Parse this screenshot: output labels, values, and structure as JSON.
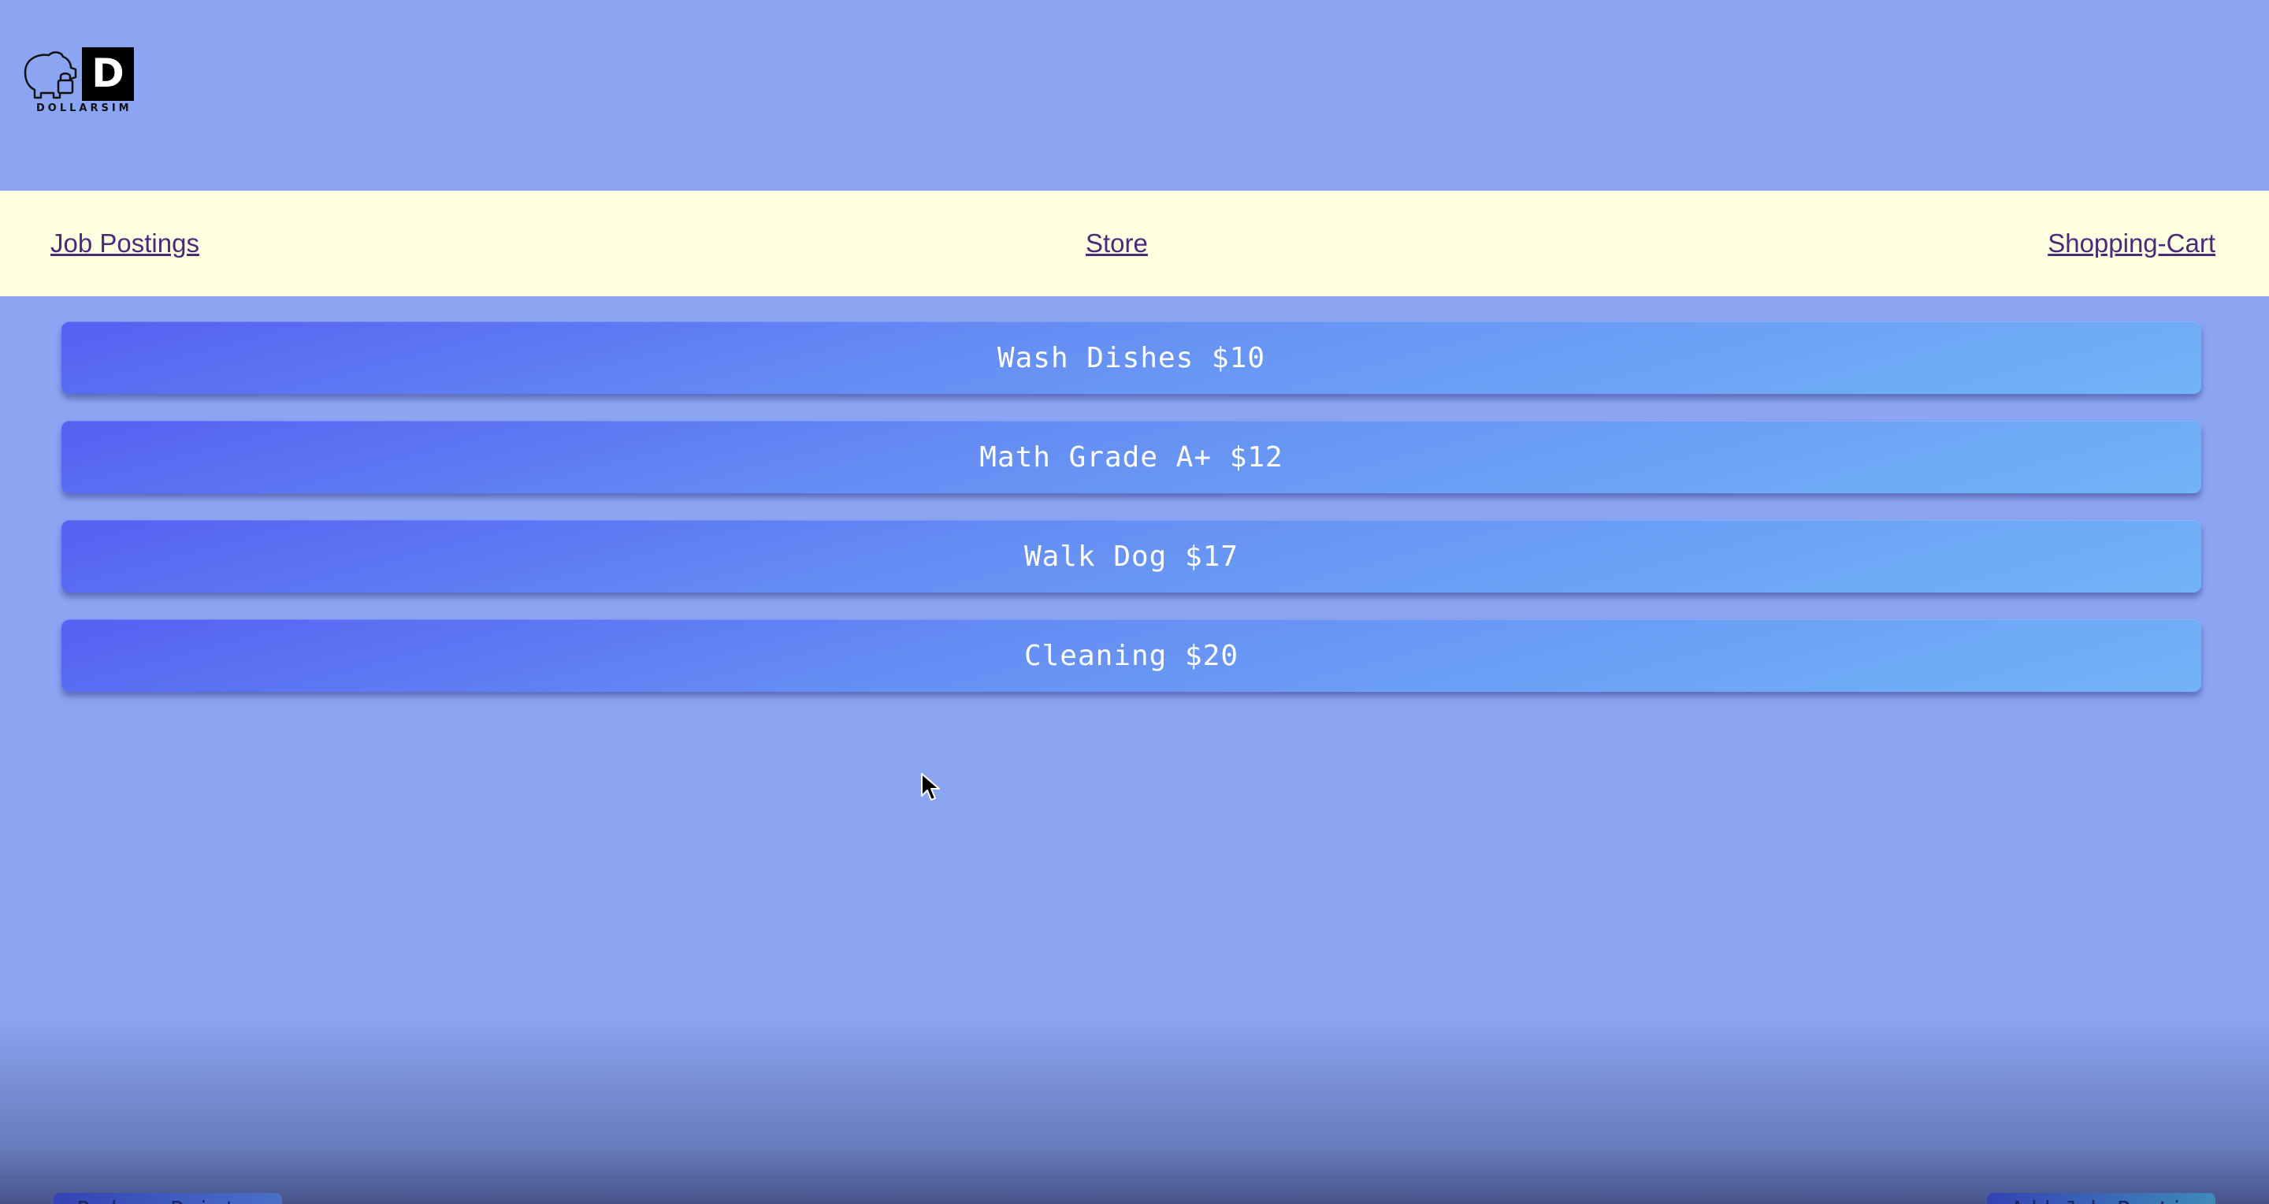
{
  "app": {
    "name": "DOLLARSIM",
    "logo_letter": "D"
  },
  "nav": {
    "items": [
      {
        "label": "Job Postings"
      },
      {
        "label": "Store"
      },
      {
        "label": "Shopping-Cart"
      }
    ]
  },
  "jobs": [
    {
      "label": "Wash Dishes $10"
    },
    {
      "label": "Math Grade A+ $12"
    },
    {
      "label": "Walk Dog $17"
    },
    {
      "label": "Cleaning $20"
    }
  ],
  "footer": {
    "left_button": "Redeem Points",
    "right_button": "Add Job Posting"
  },
  "colors": {
    "background": "#8ba5f3",
    "navbar": "#fefee0",
    "link": "#4b2a7a",
    "button_start": "#5560f2",
    "button_end": "#72b4f7"
  },
  "icons": {
    "logo": "piggy-bank-lock-icon",
    "cursor": "mouse-pointer-icon"
  }
}
